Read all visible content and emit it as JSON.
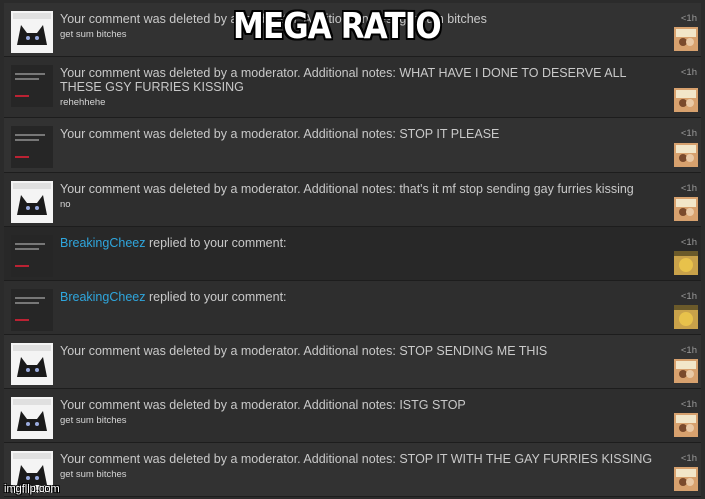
{
  "overlay_caption": "MEGA RATIO",
  "watermark": "imgflip.com",
  "notifications": [
    {
      "message": "Your comment was deleted by a moderator. Additional notes: get sum bitches",
      "note": "get sum bitches",
      "time": "<1h"
    },
    {
      "message": "Your comment was deleted by a moderator. Additional notes: WHAT HAVE I DONE TO DESERVE ALL THESE GSY FURRIES KISSING",
      "note": "rehehhehe",
      "time": "<1h"
    },
    {
      "message": "Your comment was deleted by a moderator. Additional notes: STOP IT PLEASE",
      "note": "",
      "time": "<1h"
    },
    {
      "message": "Your comment was deleted by a moderator. Additional notes: that's it mf stop sending gay furries kissing",
      "note": "no",
      "time": "<1h"
    },
    {
      "user": "BreakingCheez",
      "message": "replied to your comment:",
      "note": "",
      "time": "<1h"
    },
    {
      "user": "BreakingCheez",
      "message": "replied to your comment:",
      "note": "",
      "time": "<1h"
    },
    {
      "message": "Your comment was deleted by a moderator. Additional notes: STOP SENDING ME THIS",
      "note": "",
      "time": "<1h"
    },
    {
      "message": "Your comment was deleted by a moderator. Additional notes: ISTG STOP",
      "note": "get sum bitches",
      "time": "<1h"
    },
    {
      "message": "Your comment was deleted by a moderator. Additional notes: STOP IT WITH THE GAY FURRIES KISSING",
      "note": "get sum bitches",
      "time": "<1h"
    }
  ]
}
